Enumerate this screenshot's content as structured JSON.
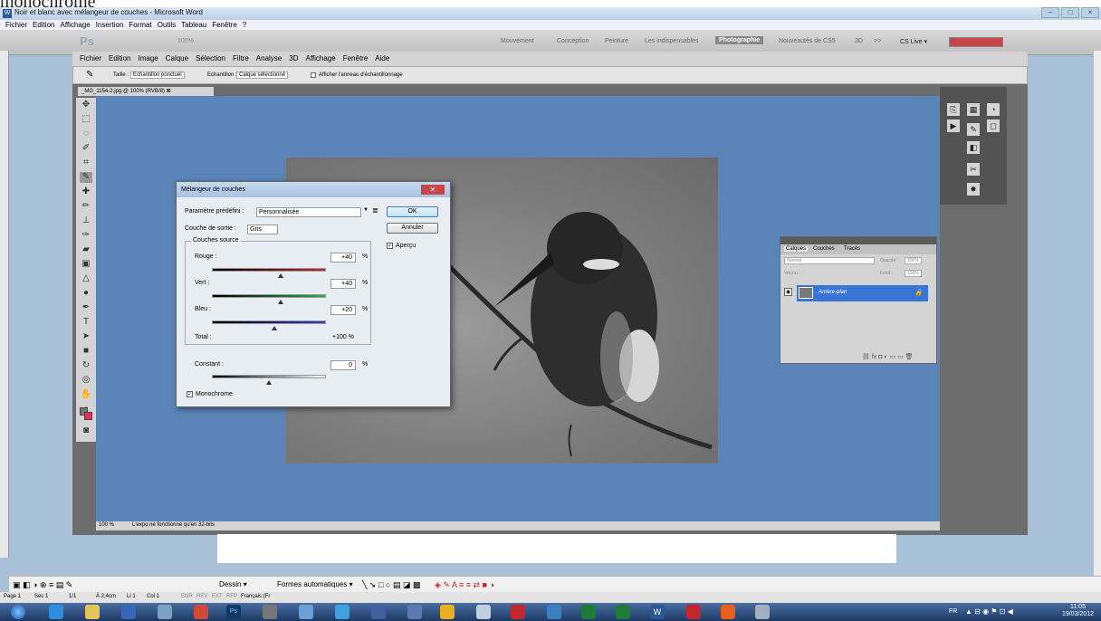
{
  "background_doc_text": "monochrome",
  "word": {
    "title": "Noir et blanc avec mélangeur de couches - Microsoft Word",
    "menu": [
      "Fichier",
      "Edition",
      "Affichage",
      "Insertion",
      "Format",
      "Outils",
      "Tableau",
      "Fenêtre",
      "?"
    ],
    "toolbar": {
      "draw": "Dessin ▾",
      "autoshapes": "Formes automatiques ▾"
    },
    "status": {
      "page": "Page 1",
      "sec": "Sec 1",
      "pages": "1/1",
      "pos": "À 2,4cm",
      "line": "Li 1",
      "col": "Col 1",
      "enr": "ENR",
      "rev": "REV",
      "ext": "EXT",
      "rfp": "RFP",
      "lang": "Français (Fr"
    }
  },
  "ps": {
    "logo": "Ps",
    "zoom_label": "100%",
    "workspaces": [
      "Mouvement",
      "Conception",
      "Peinture",
      "Les indispensables",
      "Photographie",
      "Nouveautés de CS5",
      "3D",
      ">>"
    ],
    "active_workspace": "Photographie",
    "cslive": "CS Live ▾",
    "menu": [
      "Fichier",
      "Edition",
      "Image",
      "Calque",
      "Sélection",
      "Filtre",
      "Analyse",
      "3D",
      "Affichage",
      "Fenêtre",
      "Aide"
    ],
    "options": {
      "taille_label": "Taille :",
      "taille_value": "Echantillon ponctuel",
      "echantillon_label": "Echantillon :",
      "echantillon_value": "Calque sélectionné",
      "anneau_label": "Afficher l'anneau d'échantillonnage"
    },
    "doc_tab": "_MG_1154-2.jpg @ 100% (RVB/8)",
    "status": {
      "zoom": "100 %",
      "message": "L'expo ne fonctionne qu'en 32-bits"
    }
  },
  "layers_panel": {
    "tabs": [
      "Calques",
      "Couches",
      "Tracés"
    ],
    "blend_mode": "Normal",
    "opacity_label": "Opacité :",
    "opacity": "100%",
    "lock_label": "Verrou :",
    "fill_label": "Fond :",
    "fill": "100%",
    "layer_name": "Arrière-plan"
  },
  "dialog": {
    "title": "Mélangeur de couches",
    "preset_label": "Paramètre prédéfini :",
    "preset_value": "Personnalisée",
    "output_label": "Couche de sortie :",
    "output_value": "Gris",
    "group_label": "Couches source",
    "red_label": "Rouge :",
    "red_value": "+40",
    "green_label": "Vert :",
    "green_value": "+40",
    "blue_label": "Bleu :",
    "blue_value": "+20",
    "percent": "%",
    "total_label": "Total :",
    "total_value": "+100 %",
    "constant_label": "Constant :",
    "constant_value": "0",
    "monochrome_label": "Monochrome",
    "preview_label": "Aperçu",
    "ok_label": "OK",
    "cancel_label": "Annuler",
    "red_level": 40,
    "green_level": 40,
    "blue_level": 20,
    "constant_level": 0
  },
  "clock": {
    "time": "11:05",
    "date": "19/03/2012"
  },
  "taskbar_lang": "FR",
  "colors": {
    "canvas": "#5b85b8",
    "ps_panel": "#535353",
    "layer_selected": "#3875d7",
    "dialog_close": "#c8464a"
  }
}
